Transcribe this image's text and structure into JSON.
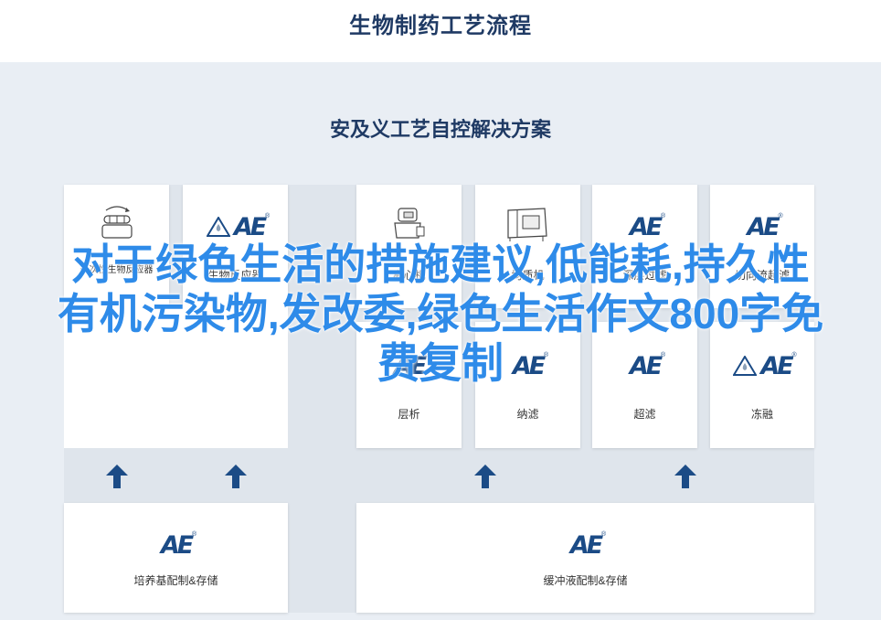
{
  "page": {
    "title": "生物制药工艺流程",
    "subtitle": "安及义工艺自控解决方案"
  },
  "top_cards": [
    {
      "label": "一次性生物反应器",
      "icon": "bioreactor-icon"
    },
    {
      "label": "生物反应器",
      "icon": "ae-logo"
    },
    {
      "label": "离心机",
      "icon": "centrifuge-icon"
    },
    {
      "label": "均质机",
      "icon": "homogenizer-icon"
    },
    {
      "label": "深层过滤",
      "icon": "ae-logo"
    },
    {
      "label": "切向流超滤",
      "icon": "ae-logo"
    }
  ],
  "middle_cards": [
    {
      "label": "层析",
      "icon": "ae-logo"
    },
    {
      "label": "纳滤",
      "icon": "ae-logo"
    },
    {
      "label": "超滤",
      "icon": "ae-logo"
    },
    {
      "label": "冻融",
      "icon": "ae-logo"
    }
  ],
  "bottom_cards": [
    {
      "label": "培养基配制&存储",
      "icon": "ae-logo"
    },
    {
      "label": "缓冲液配制&存储",
      "icon": "ae-logo"
    }
  ],
  "logo_text": "AE",
  "logo_mark": "®",
  "overlay_text": "对于绿色生活的措施建议,低能耗,持久性有机污染物,发改委,绿色生活作文800字免费复制",
  "colors": {
    "brand": "#1b4b86",
    "title": "#1f3a64",
    "panel": "#e9eef4",
    "overlay": "#2e8be9"
  }
}
